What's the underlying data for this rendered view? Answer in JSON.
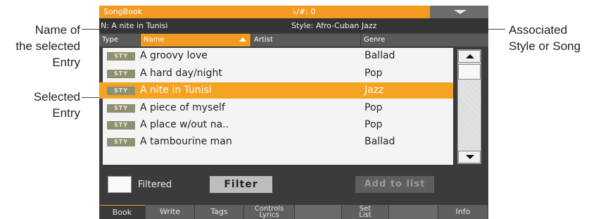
{
  "callouts": {
    "name_of_entry": "Name of\nthe selected\nEntry",
    "selected_entry": "Selected\nEntry",
    "associated_style": "Associated\nStyle or Song"
  },
  "titlebar": {
    "title": "SongBook",
    "flat_sharp": "♭/#: 0",
    "menu_icon": "chevron-down-icon"
  },
  "infobar": {
    "entry": "N: A nite in Tunisi",
    "style": "Style: Afro-Cuban Jazz"
  },
  "columns": {
    "type": "Type",
    "name": "Name",
    "artist": "Artist",
    "genre": "Genre"
  },
  "rows": [
    {
      "badge": "STY",
      "name": "A groovy love",
      "genre": "Ballad"
    },
    {
      "badge": "STY",
      "name": "A hard day/night",
      "genre": "Pop"
    },
    {
      "badge": "STY",
      "name": "A nite in Tunisi",
      "genre": "Jazz"
    },
    {
      "badge": "STY",
      "name": "A piece of myself",
      "genre": "Pop"
    },
    {
      "badge": "STY",
      "name": "A place w/out na..",
      "genre": "Pop"
    },
    {
      "badge": "STY",
      "name": "A tambourine man",
      "genre": "Ballad"
    }
  ],
  "selected_row": 2,
  "controls": {
    "filtered_label": "Filtered",
    "filter_button": "Filter",
    "add_to_list_button": "Add to list"
  },
  "tabs": [
    {
      "label": "Book"
    },
    {
      "label": "Write"
    },
    {
      "label": "Tags"
    },
    {
      "label": "Controls\nLyrics"
    },
    {
      "label": ""
    },
    {
      "label": "Set\nList"
    },
    {
      "label": ""
    },
    {
      "label": "Info"
    }
  ],
  "colors": {
    "accent": "#f39a20",
    "background": "#3b3b3b"
  }
}
